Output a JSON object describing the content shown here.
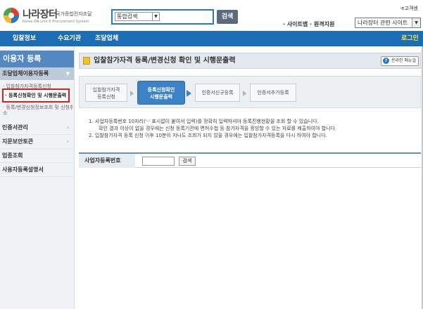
{
  "header": {
    "logo_text": "나라장터",
    "logo_sub": "국가종합전자조달",
    "logo_eng": "Korea ON-Line E-Procurement System",
    "search_select": "통합검색",
    "search_button": "검색",
    "ecustomer": "·e고객센",
    "top_links": "· 사이트맵 · 원격지원",
    "site_select": "나라장터 관련 사이트"
  },
  "gnb": {
    "items": [
      "입찰정보",
      "수요기관",
      "조달업체"
    ],
    "login": "로그인"
  },
  "sidebar": {
    "title": "이용자 등록",
    "group": "조달업체이용자등록",
    "sub1": "· 입찰참가자격등록신청",
    "active": "· 등록신청확인 및 시행문출력",
    "sub2a": "· 등록/변경신청정보조회 및 신청취",
    "sub2b": "소",
    "menus": [
      "인증서관리",
      "지문보안토큰",
      "업종조회",
      "사용자등록설명서"
    ]
  },
  "page": {
    "title": "입찰참가자격 등록/변경신청 확인 및 시행문출력",
    "manual": "온라인 매뉴얼"
  },
  "steps": [
    {
      "line1": "입찰참가자격",
      "line2": "등록신청"
    },
    {
      "line1": "등록신청확인",
      "line2": "시행문출력"
    },
    {
      "line1": "인증서신규등록",
      "line2": ""
    },
    {
      "line1": "인증서추가등록",
      "line2": ""
    }
  ],
  "notes": {
    "n1": "1.  사업자등록번호 10자리('-' 표시없이 붙여서 입력)를 정확히 입력하셔야 등록진행현황을 조회 할 수 있습니다.",
    "n1b": "확인 결과 이상이 없을 경우에는 신청 등록기관에 면허수첩 등 참가자격을 증빙할 수 있는 자료를 제출하여야 합니다.",
    "n2": "2.  입찰참가자격 등록 신청 이후 10분이 지나도 조회가 되지 않을 경우에는 입찰참가자격등록을 다시 하여야 합니다."
  },
  "form": {
    "label": "사업자등록번호",
    "button": "검색"
  },
  "colors": {
    "gnb": "#1d6db5",
    "sidebar_title": "#5388c0",
    "highlight": "#e11d1d",
    "login": "#f3e24a"
  }
}
